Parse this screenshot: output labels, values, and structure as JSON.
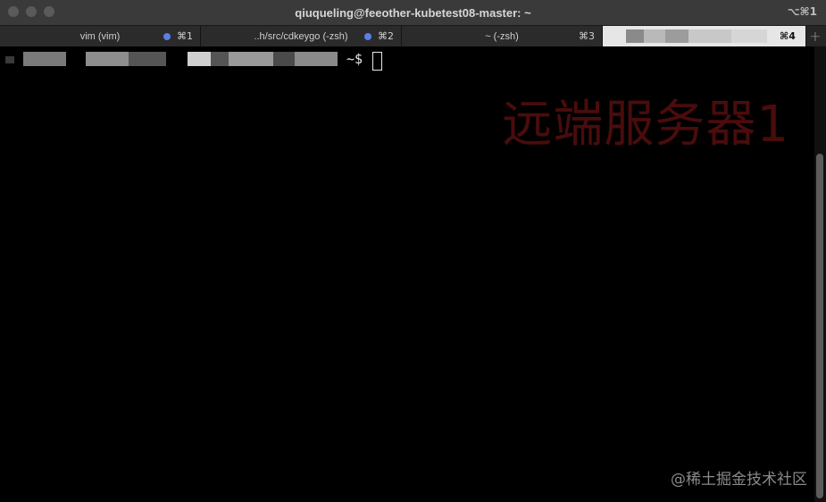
{
  "window": {
    "title": "qiuqueling@feeother-kubetest08-master: ~",
    "shortcut": "⌥⌘1"
  },
  "tabs": [
    {
      "label": "vim (vim)",
      "shortcut": "⌘1",
      "has_activity": true
    },
    {
      "label": "..h/src/cdkeygo (-zsh)",
      "shortcut": "⌘2",
      "has_activity": true
    },
    {
      "label": "~ (-zsh)",
      "shortcut": "⌘3",
      "has_activity": false
    },
    {
      "label": "",
      "shortcut": "⌘4",
      "has_activity": false,
      "active": true
    }
  ],
  "add_tab_label": "+",
  "terminal": {
    "prompt_suffix": "~$",
    "overlay_title": "远端服务器1",
    "watermark": "@稀土掘金技术社区"
  },
  "colors": {
    "titlebar": "#3a3a3a",
    "tabbar": "#262626",
    "active_tab": "#e6e6e6",
    "activity_dot": "#5b7fe6",
    "overlay_text": "#4a0c0c",
    "terminal_bg": "#000000"
  }
}
